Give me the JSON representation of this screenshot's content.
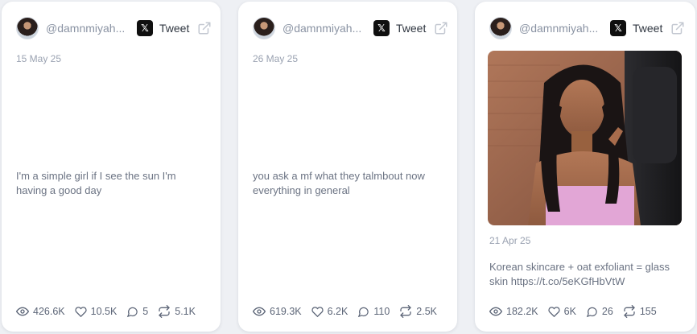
{
  "cards": [
    {
      "handle": "@damnmiyah...",
      "tweet_label": "Tweet",
      "date": "15 May 25",
      "text": "I'm a simple girl if I see the sun I'm having a good day",
      "views": "426.6K",
      "likes": "10.5K",
      "replies": "5",
      "retweets": "5.1K"
    },
    {
      "handle": "@damnmiyah...",
      "tweet_label": "Tweet",
      "date": "26 May 25",
      "text": "you ask a mf what they talmbout now everything in general",
      "views": "619.3K",
      "likes": "6.2K",
      "replies": "110",
      "retweets": "2.5K"
    },
    {
      "handle": "@damnmiyah...",
      "tweet_label": "Tweet",
      "date": "21 Apr 25",
      "text": "Korean skincare + oat exfoliant = glass skin https://t.co/5eKGfHbVtW",
      "views": "182.2K",
      "likes": "6K",
      "replies": "26",
      "retweets": "155"
    }
  ],
  "icons": {
    "platform": "x-logo-icon",
    "open": "external-link-icon",
    "views": "eye-icon",
    "likes": "heart-icon",
    "replies": "comment-icon",
    "retweets": "retweet-icon"
  },
  "colors": {
    "background": "#eef0f4",
    "card": "#ffffff",
    "muted_text": "#8a93a3",
    "body_text": "#6b7383"
  }
}
